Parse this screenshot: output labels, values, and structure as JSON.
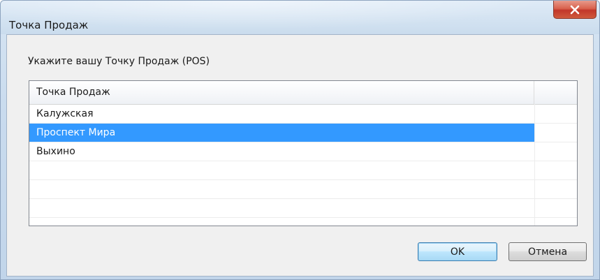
{
  "window": {
    "title": "Точка Продаж"
  },
  "dialog": {
    "prompt": "Укажите вашу Точку Продаж (POS)"
  },
  "list": {
    "column_header": "Точка Продаж",
    "rows": [
      {
        "label": "Калужская",
        "selected": false
      },
      {
        "label": "Проспект Мира",
        "selected": true
      },
      {
        "label": "Выхино",
        "selected": false
      },
      {
        "label": "",
        "selected": false
      },
      {
        "label": "",
        "selected": false
      },
      {
        "label": "",
        "selected": false
      }
    ]
  },
  "buttons": {
    "ok_label": "OK",
    "cancel_label": "Отмена"
  },
  "icons": {
    "close": "close-icon"
  },
  "colors": {
    "selection": "#3399ff",
    "close_button": "#c7402f",
    "default_button_border": "#3c7fb1"
  }
}
